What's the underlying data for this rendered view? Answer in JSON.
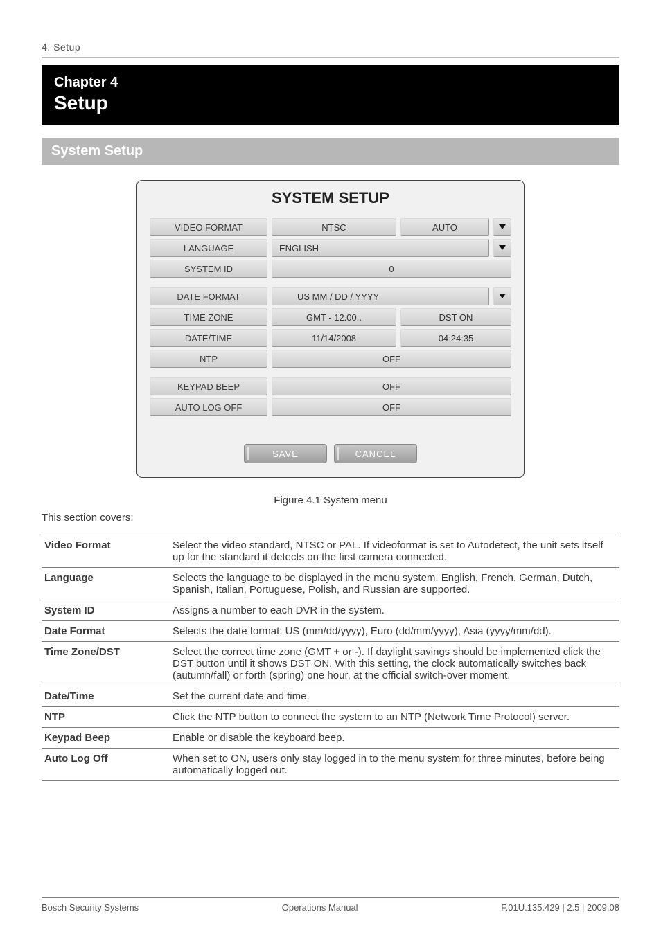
{
  "page_label": "4: Setup",
  "chapter": {
    "kicker": "Chapter 4",
    "heading": "Setup"
  },
  "section_bar": "System Setup",
  "panel": {
    "title": "SYSTEM SETUP",
    "group1": {
      "video_format": {
        "label": "VIDEO FORMAT",
        "value1": "NTSC",
        "value2": "AUTO"
      },
      "language": {
        "label": "LANGUAGE",
        "value": "ENGLISH"
      },
      "system_id": {
        "label": "SYSTEM ID",
        "value": "0"
      }
    },
    "group2": {
      "date_format": {
        "label": "DATE FORMAT",
        "value": "US    MM / DD / YYYY"
      },
      "time_zone": {
        "label": "TIME ZONE",
        "gmt": "GMT - 12.00..",
        "dst": "DST ON"
      },
      "date_time": {
        "label": "DATE/TIME",
        "date": "11/14/2008",
        "time": "04:24:35"
      },
      "ntp": {
        "label": "NTP",
        "value": "OFF"
      }
    },
    "group3": {
      "keypad_beep": {
        "label": "KEYPAD BEEP",
        "value": "OFF"
      },
      "auto_log_off": {
        "label": "AUTO LOG OFF",
        "value": "OFF"
      }
    },
    "actions": {
      "save": "SAVE",
      "cancel": "CANCEL"
    }
  },
  "figure_caption": "Figure 4.1 System menu",
  "intro": "This section covers:",
  "defs": [
    {
      "key": "Video Format",
      "val": "Select the video standard, NTSC or PAL. If videoformat is set to Autodetect, the unit sets itself up for the standard it detects on the first camera connected."
    },
    {
      "key": "Language",
      "val": "Selects the language to be displayed in the menu system. English, French, German, Dutch, Spanish, Italian, Portuguese, Polish, and Russian are supported."
    },
    {
      "key": "System ID",
      "val": "Assigns a number to each DVR in the system."
    },
    {
      "key": "Date Format",
      "val": "Selects the date format: US (mm/dd/yyyy), Euro (dd/mm/yyyy), Asia (yyyy/mm/dd)."
    },
    {
      "key": "Time Zone/DST",
      "val": "Select the correct time zone (GMT + or -). If daylight savings should be implemented click the DST button until it shows DST ON. With this setting, the clock automatically switches back (autumn/fall) or forth (spring) one hour, at the official switch-over moment."
    },
    {
      "key": "Date/Time",
      "val": "Set the current date and time."
    },
    {
      "key": "NTP",
      "val": "Click the NTP button to connect the system to an NTP (Network Time Protocol) server."
    },
    {
      "key": "Keypad Beep",
      "val": "Enable or disable the keyboard beep."
    },
    {
      "key": "Auto Log Off",
      "val": "When set to ON, users only stay logged in to the menu system for three minutes, before being automatically logged out."
    }
  ],
  "footer": {
    "left": "Bosch Security Systems",
    "center": "Operations Manual",
    "right": "F.01U.135.429 | 2.5 | 2009.08"
  }
}
